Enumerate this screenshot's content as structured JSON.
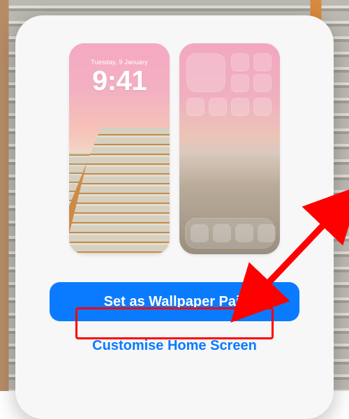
{
  "lock_screen": {
    "date_label": "Tuesday, 9 January",
    "time_label": "9:41"
  },
  "buttons": {
    "primary_label": "Set as Wallpaper Pair",
    "secondary_label": "Customise Home Screen"
  },
  "annotation": {
    "highlight_target": "customise-home-screen-button",
    "arrow_target": "set-wallpaper-pair-button",
    "color": "#ff0000"
  },
  "colors": {
    "accent": "#0a7bff"
  }
}
